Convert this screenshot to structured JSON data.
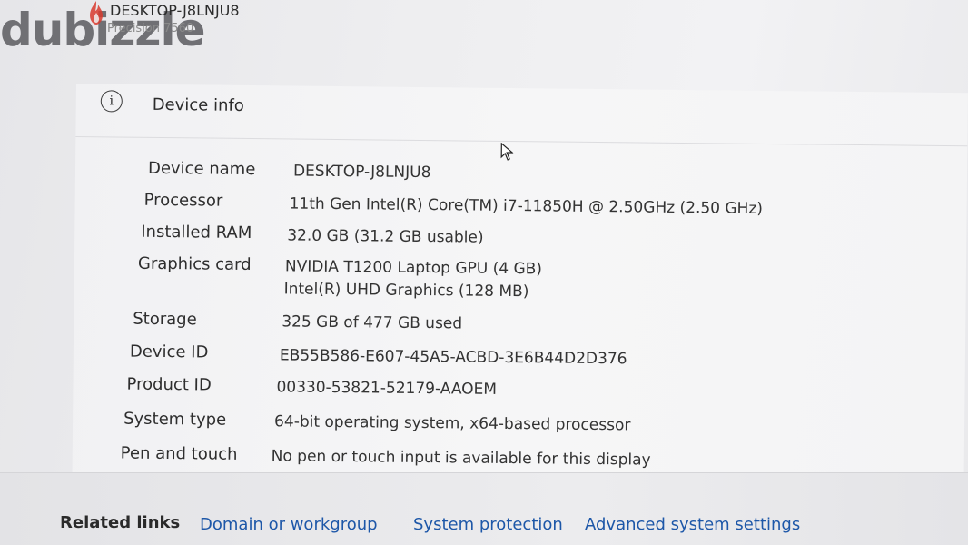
{
  "watermark": {
    "brand": "dubizzle"
  },
  "device_header": {
    "name": "DESKTOP-J8LNJU8",
    "model": "Precision 7560"
  },
  "device_info": {
    "title": "Device info",
    "icon": "info-icon",
    "rows": [
      {
        "label": "Device name",
        "values": [
          "DESKTOP-J8LNJU8"
        ]
      },
      {
        "label": "Processor",
        "values": [
          "11th Gen Intel(R) Core(TM) i7-11850H @ 2.50GHz   (2.50 GHz)"
        ]
      },
      {
        "label": "Installed RAM",
        "values": [
          "32.0 GB (31.2 GB usable)"
        ]
      },
      {
        "label": "Graphics card",
        "values": [
          "NVIDIA T1200 Laptop GPU (4 GB)",
          "Intel(R) UHD Graphics (128 MB)"
        ]
      },
      {
        "label": "Storage",
        "values": [
          "325 GB of 477 GB used"
        ]
      },
      {
        "label": "Device ID",
        "values": [
          "EB55B586-E607-45A5-ACBD-3E6B44D2D376"
        ]
      },
      {
        "label": "Product ID",
        "values": [
          "00330-53821-52179-AAOEM"
        ]
      },
      {
        "label": "System type",
        "values": [
          "64-bit operating system, x64-based processor"
        ]
      },
      {
        "label": "Pen and touch",
        "values": [
          "No pen or touch input is available for this display"
        ]
      }
    ]
  },
  "related_links": {
    "label": "Related links",
    "links": [
      "Domain or workgroup",
      "System protection",
      "Advanced system settings"
    ]
  },
  "colors": {
    "link": "#1d57a8",
    "watermark": "#5a5a5f",
    "flame_red": "#d83a2e"
  }
}
